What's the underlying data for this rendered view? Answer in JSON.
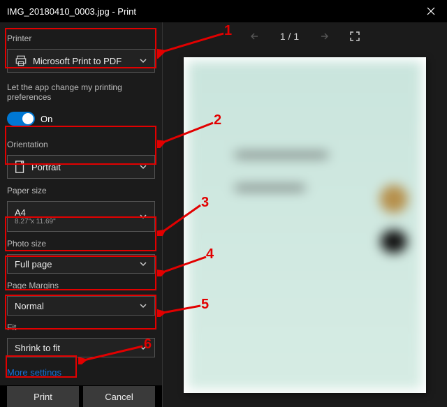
{
  "window": {
    "title": "IMG_20180410_0003.jpg - Print"
  },
  "labels": {
    "printer": "Printer",
    "pref": "Let the app change my printing preferences",
    "toggle_state": "On",
    "orientation": "Orientation",
    "paper_size": "Paper size",
    "photo_size": "Photo size",
    "page_margins": "Page Margins",
    "fit": "Fit",
    "more": "More settings"
  },
  "values": {
    "printer": "Microsoft Print to PDF",
    "orientation": "Portrait",
    "paper_size": "A4",
    "paper_size_dim": "8.27\"x 11.69\"",
    "photo_size": "Full page",
    "page_margins": "Normal",
    "fit": "Shrink to fit"
  },
  "nav": {
    "page_indicator": "1 / 1"
  },
  "buttons": {
    "print": "Print",
    "cancel": "Cancel"
  },
  "annotations": {
    "n1": "1",
    "n2": "2",
    "n3": "3",
    "n4": "4",
    "n5": "5",
    "n6": "6"
  }
}
